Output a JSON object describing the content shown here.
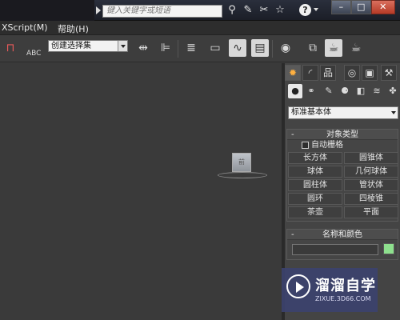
{
  "titlebar": {
    "search_placeholder": "键入关键字或短语",
    "icons": [
      "binoculars-icon",
      "wrench-icon",
      "satellite-icon",
      "star-icon",
      "help-icon"
    ],
    "help_label": "?"
  },
  "window_controls": {
    "minimize": "–",
    "restore": "□",
    "close": "✕"
  },
  "menubar": {
    "items": [
      {
        "label": "XScript(M)"
      },
      {
        "label": "帮助(H)"
      }
    ]
  },
  "toolbar": {
    "selection_set_label": "创建选择集",
    "abc_label": "ABC"
  },
  "viewport": {
    "viewcube_label": "前"
  },
  "command_panel": {
    "category_value": "标准基本体",
    "object_type": {
      "title": "对象类型",
      "autogrid_label": "自动栅格",
      "buttons": [
        "长方体",
        "圆锥体",
        "球体",
        "几何球体",
        "圆柱体",
        "管状体",
        "圆环",
        "四棱锥",
        "茶壶",
        "平面"
      ]
    },
    "name_color": {
      "title": "名称和颜色",
      "swatch_color": "#8ee08e"
    }
  },
  "watermark": {
    "title": "溜溜自学",
    "url": "ZIXUE.3D66.COM"
  }
}
